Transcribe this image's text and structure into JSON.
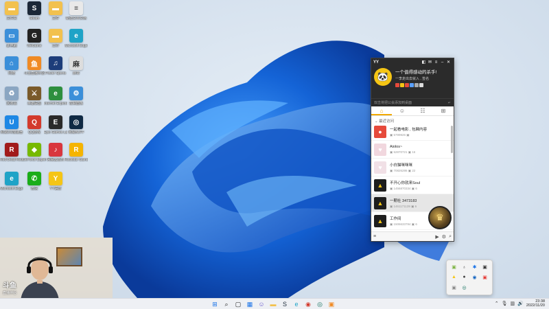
{
  "desktop": {
    "icons": [
      {
        "name": "文件夹",
        "glyph": "▬",
        "color": "#f2c14e"
      },
      {
        "name": "Steam",
        "glyph": "S",
        "color": "#1b2838"
      },
      {
        "name": "文件",
        "glyph": "▬",
        "color": "#f2c14e"
      },
      {
        "name": "新建文本文档",
        "glyph": "≡",
        "color": "#e9e9e9"
      },
      {
        "name": "此电脑",
        "glyph": "▭",
        "color": "#3b8fd9"
      },
      {
        "name": "WeGame",
        "glyph": "G",
        "color": "#222222"
      },
      {
        "name": "文件",
        "glyph": "▬",
        "color": "#f2c14e"
      },
      {
        "name": "Microsoft Edge",
        "glyph": "e",
        "color": "#1fa3c7"
      },
      {
        "name": "网络",
        "glyph": "⌂",
        "color": "#3b8fd9"
      },
      {
        "name": "斗鱼直播伴侣",
        "glyph": "鱼",
        "color": "#f08a24"
      },
      {
        "name": "Power Sports",
        "glyph": "♫",
        "color": "#1d3d7a"
      },
      {
        "name": "麻将",
        "glyph": "麻",
        "color": "#dddddd"
      },
      {
        "name": "回收站",
        "glyph": "♻",
        "color": "#8aa6c2"
      },
      {
        "name": "英雄联盟",
        "glyph": "⚔",
        "color": "#7a5a2a"
      },
      {
        "name": "Internet Explorer",
        "glyph": "e",
        "color": "#2d8f3e"
      },
      {
        "name": "控制面板",
        "glyph": "⚙",
        "color": "#3b8fd9"
      },
      {
        "name": "网易UU加速器",
        "glyph": "U",
        "color": "#1e88e5"
      },
      {
        "name": "QQ游戏",
        "glyph": "Q",
        "color": "#d33a2c"
      },
      {
        "name": "Epic Games Launcher",
        "glyph": "E",
        "color": "#2a2a2a"
      },
      {
        "name": "网易BUFF",
        "glyph": "◎",
        "color": "#0f2a44"
      },
      {
        "name": "Red Dead Redemption",
        "glyph": "R",
        "color": "#a11b1b"
      },
      {
        "name": "GeForce Experience",
        "glyph": "◆",
        "color": "#76b900"
      },
      {
        "name": "网易云音乐",
        "glyph": "♪",
        "color": "#d9363e"
      },
      {
        "name": "Rockstar Games Launcher",
        "glyph": "R",
        "color": "#f5b400"
      },
      {
        "name": "Microsoft Edge",
        "glyph": "e",
        "color": "#1fa3c7"
      },
      {
        "name": "微信",
        "glyph": "✆",
        "color": "#1aad19"
      },
      {
        "name": "YY语音",
        "glyph": "Y",
        "color": "#f5c515"
      }
    ]
  },
  "yy": {
    "title": "YY",
    "nickname": "一个值得感动的杀手!",
    "signature": "一李走出去就入 , 签名",
    "search_placeholder": "双击将把公会添加到桌面",
    "tabs": [
      {
        "icon": "⌂",
        "active": true
      },
      {
        "icon": "☺",
        "active": false
      },
      {
        "icon": "☷",
        "active": false
      },
      {
        "icon": "⊞",
        "active": false
      }
    ],
    "section_label": "最近访问",
    "rows": [
      {
        "name": "一起看电影 , 包厢内容",
        "id": "5799926",
        "count": "",
        "icon": "●",
        "bg": "#e64a3b",
        "sel": false
      },
      {
        "name": "Aiolos~",
        "id": "52870721",
        "count": "16",
        "icon": "♥",
        "bg": "#f1d7de",
        "sel": false
      },
      {
        "name": "小白猫咪咪咪",
        "id": "70826286",
        "count": "22",
        "icon": "♥",
        "bg": "#f1e0e6",
        "sel": false
      },
      {
        "name": "不开心你就来Soul",
        "id": "1456870334",
        "count": "6",
        "icon": "▲",
        "bg": "#1d1d1d",
        "sel": false
      },
      {
        "name": "一期社 3473183",
        "id": "1461171139",
        "count": "6",
        "icon": "▲",
        "bg": "#1d1d1d",
        "sel": true
      },
      {
        "name": "工作间",
        "id": "1506633784",
        "count": "6",
        "icon": "▲",
        "bg": "#1d1d1d",
        "sel": false
      }
    ],
    "bottom_icons": [
      "menu-icon",
      "video-icon",
      "settings-icon",
      "search-icon"
    ]
  },
  "tray": {
    "icons": [
      "▣",
      "♁",
      "✱",
      "▣",
      "▲",
      "●",
      "◉",
      "▣",
      "▣",
      "◎"
    ]
  },
  "webcam": {
    "logo": "斗鱼",
    "logo_sub": "直播伴侣"
  },
  "taskbar": {
    "apps": [
      {
        "icon": "⊞",
        "name": "start",
        "color": "#1a73e8"
      },
      {
        "icon": "⌕",
        "name": "search",
        "color": "#222"
      },
      {
        "icon": "▢",
        "name": "task-view",
        "color": "#222"
      },
      {
        "icon": "▦",
        "name": "widgets",
        "color": "#1a73e8"
      },
      {
        "icon": "☺",
        "name": "chat",
        "color": "#6a5acd"
      },
      {
        "icon": "▬",
        "name": "file-explorer",
        "color": "#f2c14e"
      },
      {
        "icon": "S",
        "name": "steam",
        "color": "#1b2838"
      },
      {
        "icon": "e",
        "name": "edge",
        "color": "#1fa3c7"
      },
      {
        "icon": "◉",
        "name": "app",
        "color": "#d33a2c"
      },
      {
        "icon": "◎",
        "name": "app2",
        "color": "#0f6f5c"
      },
      {
        "icon": "▣",
        "name": "app3",
        "color": "#f08a24"
      }
    ],
    "time": "23:38",
    "date": "2022/11/20"
  }
}
